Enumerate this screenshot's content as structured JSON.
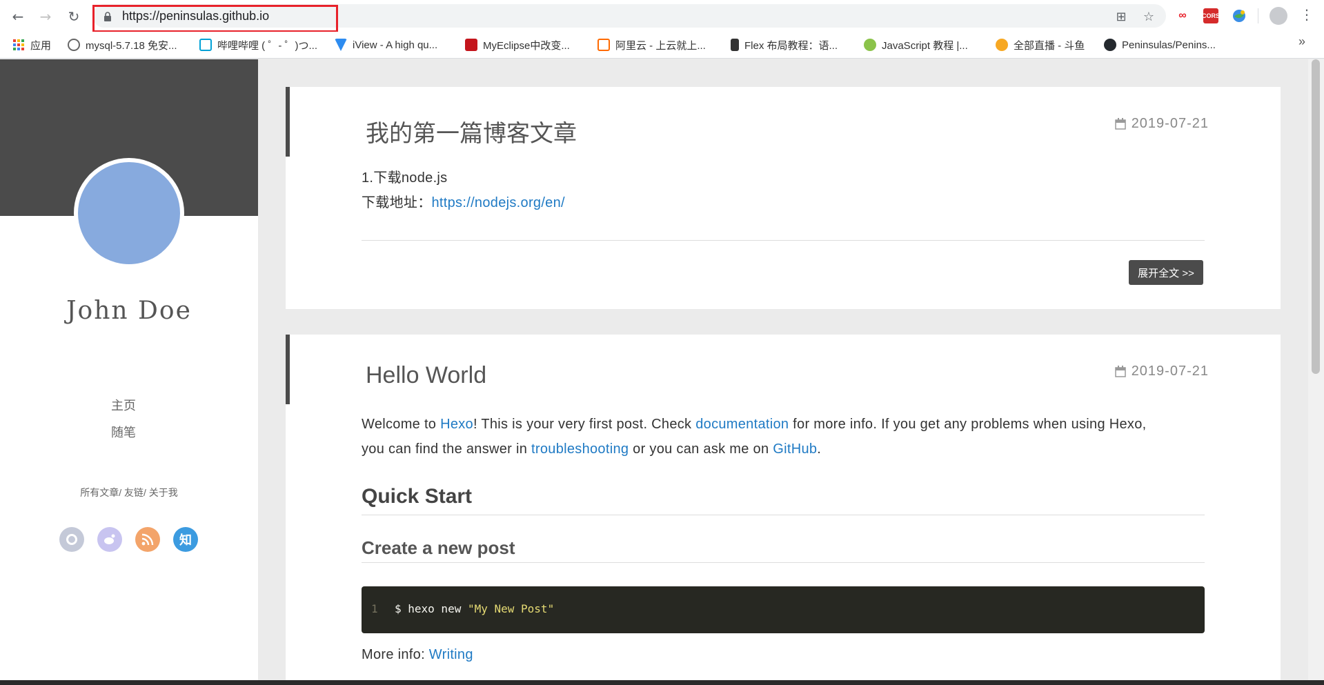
{
  "browser": {
    "url": "https://peninsulas.github.io",
    "bookmarks": [
      {
        "label": "应用",
        "color": "#e94235"
      },
      {
        "label": "mysql-5.7.18 免安...",
        "color": "#666666"
      },
      {
        "label": "哔哩哔哩 ( ゜- ゜)つ...",
        "color": "#00a1d6"
      },
      {
        "label": "iView - A high qu...",
        "color": "#2d8cf0"
      },
      {
        "label": "MyEclipse中改变...",
        "color": "#c4151c"
      },
      {
        "label": "阿里云 - 上云就上...",
        "color": "#ff6a00"
      },
      {
        "label": "Flex 布局教程：语...",
        "color": "#333333"
      },
      {
        "label": "JavaScript 教程 |...",
        "color": "#8bc34a"
      },
      {
        "label": "全部直播 - 斗鱼",
        "color": "#f7a823"
      },
      {
        "label": "Peninsulas/Penins...",
        "color": "#24292e"
      }
    ],
    "more": "»",
    "ext_cors": "CORS"
  },
  "sidebar": {
    "author": "John Doe",
    "nav": [
      "主页",
      "随笔"
    ],
    "links": "所有文章/  友链/  关于我",
    "social": [
      {
        "icon": "github-icon",
        "color": "#c4c9d8",
        "glyph": "●"
      },
      {
        "icon": "weibo-icon",
        "color": "#c8c4f0",
        "glyph": "●"
      },
      {
        "icon": "rss-icon",
        "color": "#f3a46a",
        "glyph": "●"
      },
      {
        "icon": "zhihu-icon",
        "color": "#3c9be0",
        "glyph": "知"
      }
    ]
  },
  "posts": [
    {
      "title": "我的第一篇博客文章",
      "date": "2019-07-21",
      "line1": "1.下载node.js",
      "line2_label": "下载地址：",
      "line2_link": "https://nodejs.org/en/",
      "more": "展开全文 >>"
    },
    {
      "title": "Hello World",
      "date": "2019-07-21",
      "p1": {
        "t1": "Welcome to ",
        "l1": "Hexo",
        "t2": "! This is your very first post. Check ",
        "l2": "documentation",
        "t3": " for more info. If you get any problems when using Hexo,",
        "t4": "you can find the answer in ",
        "l3": "troubleshooting",
        "t5": " or you can ask me on ",
        "l4": "GitHub",
        "t6": "."
      },
      "h2": "Quick Start",
      "h3": "Create a new post",
      "code": {
        "ln": "1",
        "cmd": "$ hexo new ",
        "str": "\"My New Post\""
      },
      "more_info_label": "More info: ",
      "more_info_link": "Writing"
    }
  ]
}
